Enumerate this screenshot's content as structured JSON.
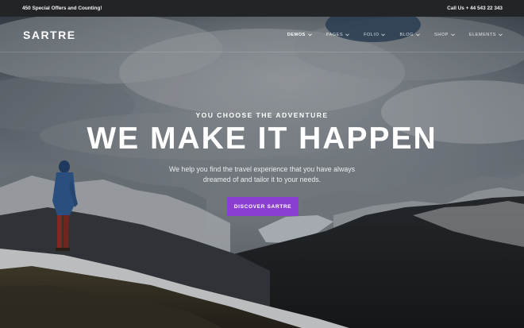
{
  "topbar": {
    "offers_text": "450 Special Offers and Counting!",
    "contact_text": "Call Us + 44 543 22 343"
  },
  "header": {
    "logo": "SARTRE",
    "nav": [
      {
        "label": "DEMOS",
        "active": true
      },
      {
        "label": "PAGES",
        "active": false
      },
      {
        "label": "FOLIO",
        "active": false
      },
      {
        "label": "BLOG",
        "active": false
      },
      {
        "label": "SHOP",
        "active": false
      },
      {
        "label": "ELEMENTS",
        "active": false
      }
    ]
  },
  "hero": {
    "eyebrow": "YOU CHOOSE THE ADVENTURE",
    "headline": "WE MAKE IT HAPPEN",
    "subtext_line1": "We help you find the travel experience that you have always",
    "subtext_line2": "dreamed of and tailor it to your needs.",
    "cta_label": "DISCOVER SARTRE",
    "cta_color": "#8a3fd1"
  }
}
